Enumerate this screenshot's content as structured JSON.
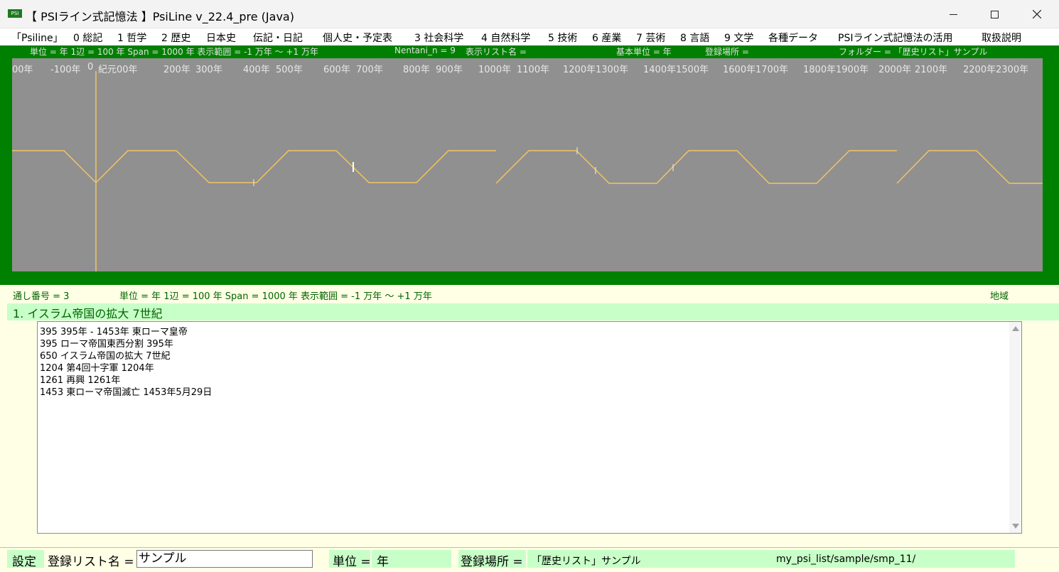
{
  "window": {
    "icon_text": "PSI",
    "title": "【 PSIライン式記憶法 】PsiLine v_22.4_pre (Java)"
  },
  "menu": [
    "「Psiline」",
    "0 総記",
    "1 哲学",
    "2 歴史",
    "日本史",
    "伝記・日記",
    "個人史・予定表",
    "3 社会科学",
    "4 自然科学",
    "5 技術",
    "6 産業",
    "7 芸術",
    "8 言語",
    "9 文学",
    "各種データ",
    "PSIライン式記憶法の活用",
    "取扱説明"
  ],
  "info": {
    "scale": "単位 = 年  1辺 = 100 年  Span = 1000 年  表示範囲 = -1 万年 ～ +1 万年",
    "nentani": "Nentani_n = 9",
    "list_name": "表示リスト名 =",
    "base_unit": "基本単位 = 年",
    "location": "登録場所 =",
    "folder": "フォルダー = 「歴史リスト」サンプル"
  },
  "timeline": {
    "tick_labels": [
      "00年",
      "-100年",
      "0",
      "紀元00年",
      "200年",
      "300年",
      "400年",
      "500年",
      "600年",
      "700年",
      "800年",
      "900年",
      "1000年",
      "1100年",
      "1200年",
      "1300年",
      "1400年",
      "1500年",
      "1600年",
      "1700年",
      "1800年",
      "1900年",
      "2000年",
      "2100年",
      "2200年",
      "2300年"
    ],
    "line_color": "#f2c462",
    "background": "#909090",
    "marker_color": "#ffffff"
  },
  "status": {
    "serial": "通し番号 = 3",
    "scale": "単位 = 年  1辺 = 100 年  Span = 1000 年  表示範囲 = -1 万年 ～ +1 万年",
    "region": "地域"
  },
  "heading": "1. イスラム帝国の拡大 7世紀",
  "entries": [
    "395  395年 - 1453年 東ローマ皇帝",
    "395  ローマ帝国東西分割 395年",
    "650  イスラム帝国の拡大 7世紀",
    "1204  第4回十字軍 1204年",
    "1261  再興 1261年",
    "1453  東ローマ帝国滅亡 1453年5月29日"
  ],
  "bottom": {
    "settings": "設定",
    "list_label": "登録リスト名 =",
    "list_value": "サンプル",
    "unit_label": "単位 =",
    "unit_value": "年",
    "location_label": "登録場所 =",
    "location_value": "「歴史リスト」サンプル",
    "path": "my_psi_list/sample/smp_11/"
  }
}
